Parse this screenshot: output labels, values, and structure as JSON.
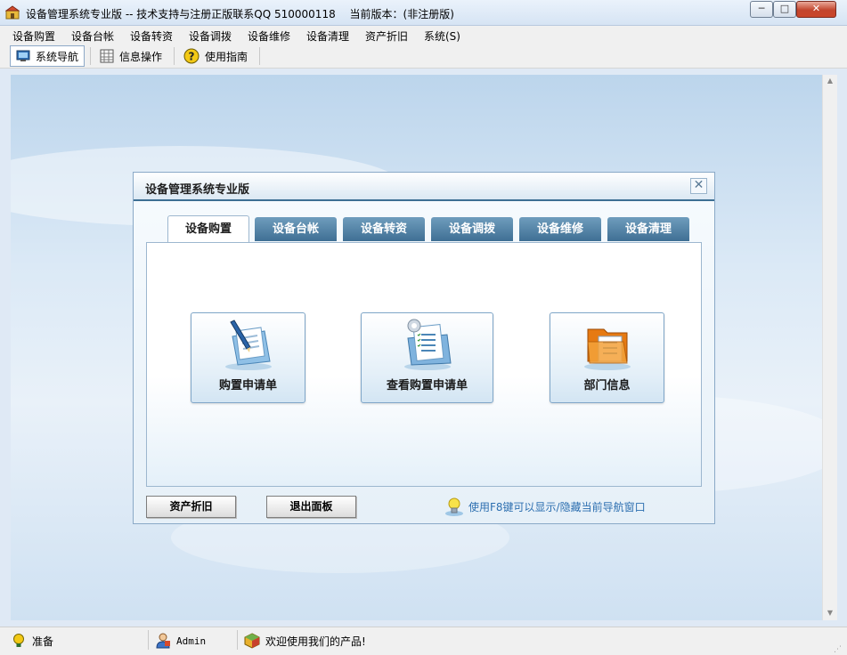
{
  "window": {
    "title": "设备管理系统专业版 -- 技术支持与注册正版联系QQ 510000118　 当前版本：(非注册版)",
    "minimize_label": "─",
    "maximize_label": "□",
    "close_label": "✕"
  },
  "menu": {
    "items": [
      {
        "label": "设备购置"
      },
      {
        "label": "设备台帐"
      },
      {
        "label": "设备转资"
      },
      {
        "label": "设备调拨"
      },
      {
        "label": "设备维修"
      },
      {
        "label": "设备清理"
      },
      {
        "label": "资产折旧"
      },
      {
        "label": "系统(S)"
      }
    ]
  },
  "toolbar": {
    "items": [
      {
        "label": "系统导航",
        "icon": "monitor-icon",
        "active": true
      },
      {
        "label": "信息操作",
        "icon": "grid-icon",
        "active": false
      },
      {
        "label": "使用指南",
        "icon": "help-icon",
        "active": false
      }
    ]
  },
  "panel": {
    "title": "设备管理系统专业版",
    "close_label": "✕",
    "tabs": [
      {
        "label": "设备购置",
        "active": true
      },
      {
        "label": "设备台帐",
        "active": false
      },
      {
        "label": "设备转资",
        "active": false
      },
      {
        "label": "设备调拨",
        "active": false
      },
      {
        "label": "设备维修",
        "active": false
      },
      {
        "label": "设备清理",
        "active": false
      }
    ],
    "buttons": [
      {
        "label": "购置申请单",
        "icon": "pen-document-icon"
      },
      {
        "label": "查看购置申请单",
        "icon": "checklist-folder-icon"
      },
      {
        "label": "部门信息",
        "icon": "orange-folder-icon"
      }
    ],
    "footer": {
      "asset_button": "资产折旧",
      "exit_button": "退出面板",
      "hint": "使用F8键可以显示/隐藏当前导航窗口",
      "hint_icon": "lightbulb-icon"
    }
  },
  "statusbar": {
    "ready": "准备",
    "user": "Admin",
    "welcome": "欢迎使用我们的产品!"
  },
  "colors": {
    "tab_bg": "#4f7fa3",
    "hint_text": "#2d6fb0",
    "panel_border": "#8aa9c7"
  }
}
